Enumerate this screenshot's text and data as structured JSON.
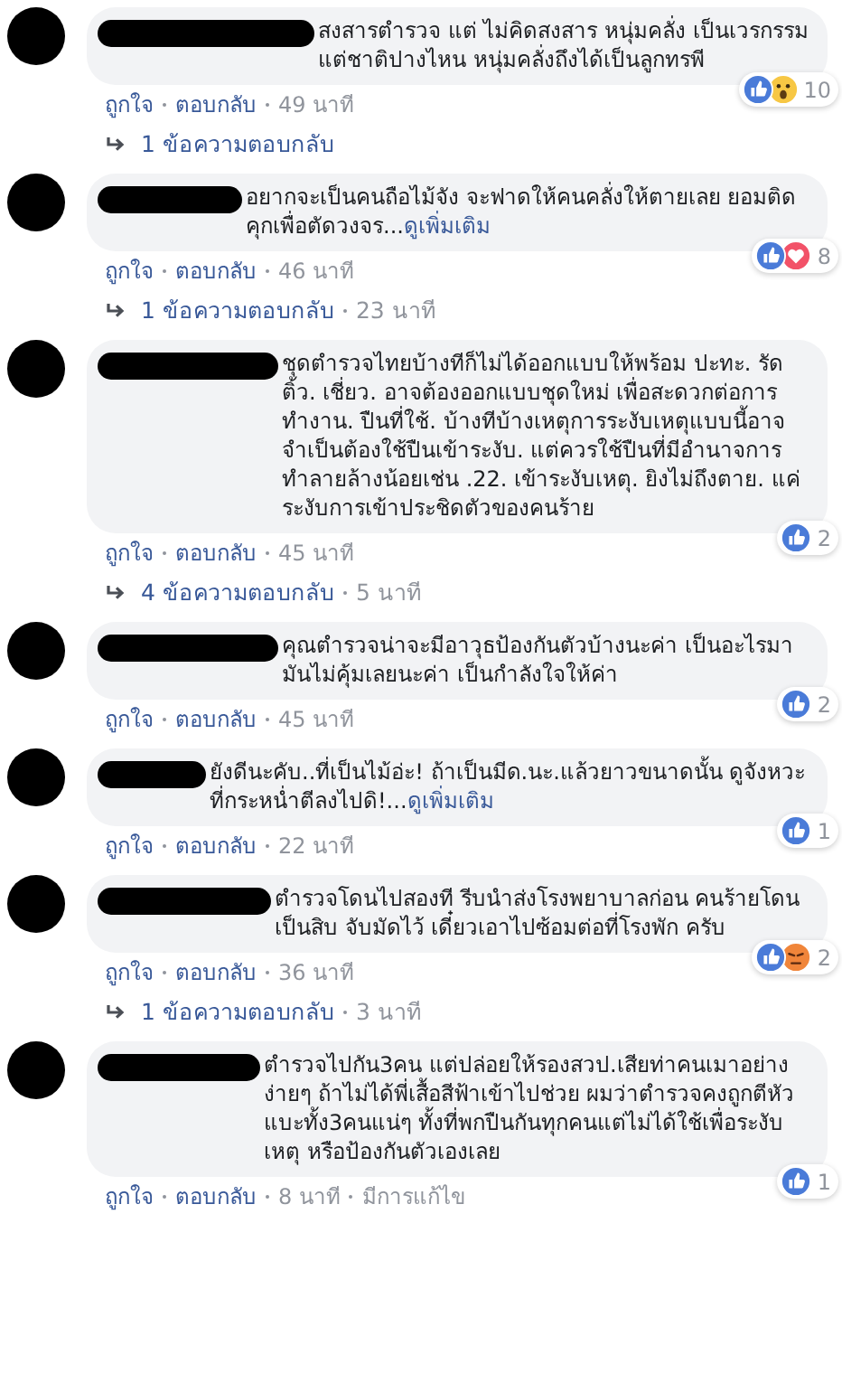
{
  "comments": [
    {
      "text": "สงสารตำรวจ แต่ ไม่คิดสงสาร หนุ่มคลั่ง เป็นเวรกรรมแต่ชาติปางไหน หนุ่มคลั่งถึงได้เป็นลูกทรพี",
      "reactions": {
        "icons": [
          {
            "kind": "like"
          },
          {
            "kind": "wow"
          }
        ],
        "count": "10"
      },
      "actions": {
        "like": "ถูกใจ",
        "reply": "ตอบกลับ",
        "time": "49 นาที"
      },
      "replies": {
        "label": "1 ข้อความตอบกลับ"
      }
    },
    {
      "text": "อยากจะเป็นคนถือไม้จัง จะฟาดให้คนคลั่งให้ตายเลย ยอมติดคุกเพื่อตัดวงจร...",
      "more": "ดูเพิ่มเติม",
      "reactions": {
        "icons": [
          {
            "kind": "like"
          },
          {
            "kind": "love"
          }
        ],
        "count": "8"
      },
      "actions": {
        "like": "ถูกใจ",
        "reply": "ตอบกลับ",
        "time": "46 นาที"
      },
      "replies": {
        "label": "1 ข้อความตอบกลับ",
        "time": "23 นาที"
      }
    },
    {
      "text": "ชุดตำรวจไทยบ้างทีก็ไม่ได้ออกแบบให้พร้อม ปะทะ. รัดติ้ว. เชี่ยว. อาจต้องออกแบบชุดใหม่ เพื่อสะดวกต่อการทำงาน. ปืนที่ใช้. บ้างทีบ้างเหตุการระงับเหตุแบบนี้อาจจำเป็นต้องใช้ปืนเข้าระงับ. แต่ควรใช้ปืนที่มีอำนาจการทำลายล้างน้อยเช่น .22. เข้าระงับเหตุ. ยิงไม่ถึงตาย. แค่ระงับการเข้าประชิดตัวของคนร้าย",
      "reactions": {
        "icons": [
          {
            "kind": "like"
          }
        ],
        "count": "2"
      },
      "actions": {
        "like": "ถูกใจ",
        "reply": "ตอบกลับ",
        "time": "45 นาที"
      },
      "replies": {
        "label": "4 ข้อความตอบกลับ",
        "time": "5 นาที"
      }
    },
    {
      "text": "คุณตำรวจน่าจะมีอาวุธป้องกันตัวบ้างนะค่า เป็นอะไรมามันไม่คุ้มเลยนะค่า เป็นกำลังใจให้ค่า",
      "reactions": {
        "icons": [
          {
            "kind": "like"
          }
        ],
        "count": "2"
      },
      "actions": {
        "like": "ถูกใจ",
        "reply": "ตอบกลับ",
        "time": "45 นาที"
      }
    },
    {
      "text": "ยังดีนะคับ..ที่เป็นไม้อ่ะ! ถ้าเป็นมีด.นะ.แล้วยาวขนาดนั้น ดูจังหวะที่กระหน่ำตีลงไปดิ!...",
      "more": "ดูเพิ่มเติม",
      "reactions": {
        "icons": [
          {
            "kind": "like"
          }
        ],
        "count": "1"
      },
      "actions": {
        "like": "ถูกใจ",
        "reply": "ตอบกลับ",
        "time": "22 นาที"
      }
    },
    {
      "text": "ตำรวจโดนไปสองที รีบนำส่งโรงพยาบาลก่อน คนร้ายโดนเป็นสิบ จับมัดไว้ เดี๋ยวเอาไปซ้อมต่อที่โรงพัก ครับ",
      "reactions": {
        "icons": [
          {
            "kind": "like"
          },
          {
            "kind": "angry"
          }
        ],
        "count": "2"
      },
      "actions": {
        "like": "ถูกใจ",
        "reply": "ตอบกลับ",
        "time": "36 นาที"
      },
      "replies": {
        "label": "1 ข้อความตอบกลับ",
        "time": "3 นาที"
      }
    },
    {
      "text": "ตำรวจไปกัน3คน แต่ปล่อยให้รองสวป.เสียท่าคนเมาอย่างง่ายๆ ถ้าไม่ได้พี่เสื้อสีฟ้าเข้าไปช่วย ผมว่าตำรวจคงถูกตีหัวแบะทั้ง3คนแน่ๆ ทั้งที่พกปืนกันทุกคนแต่ไม่ได้ใช้เพื่อระงับเหตุ หรือป้องกันตัวเองเลย",
      "reactions": {
        "icons": [
          {
            "kind": "like"
          }
        ],
        "count": "1"
      },
      "actions": {
        "like": "ถูกใจ",
        "reply": "ตอบกลับ",
        "time": "8 นาที",
        "edited": "มีการแก้ไข"
      }
    }
  ]
}
